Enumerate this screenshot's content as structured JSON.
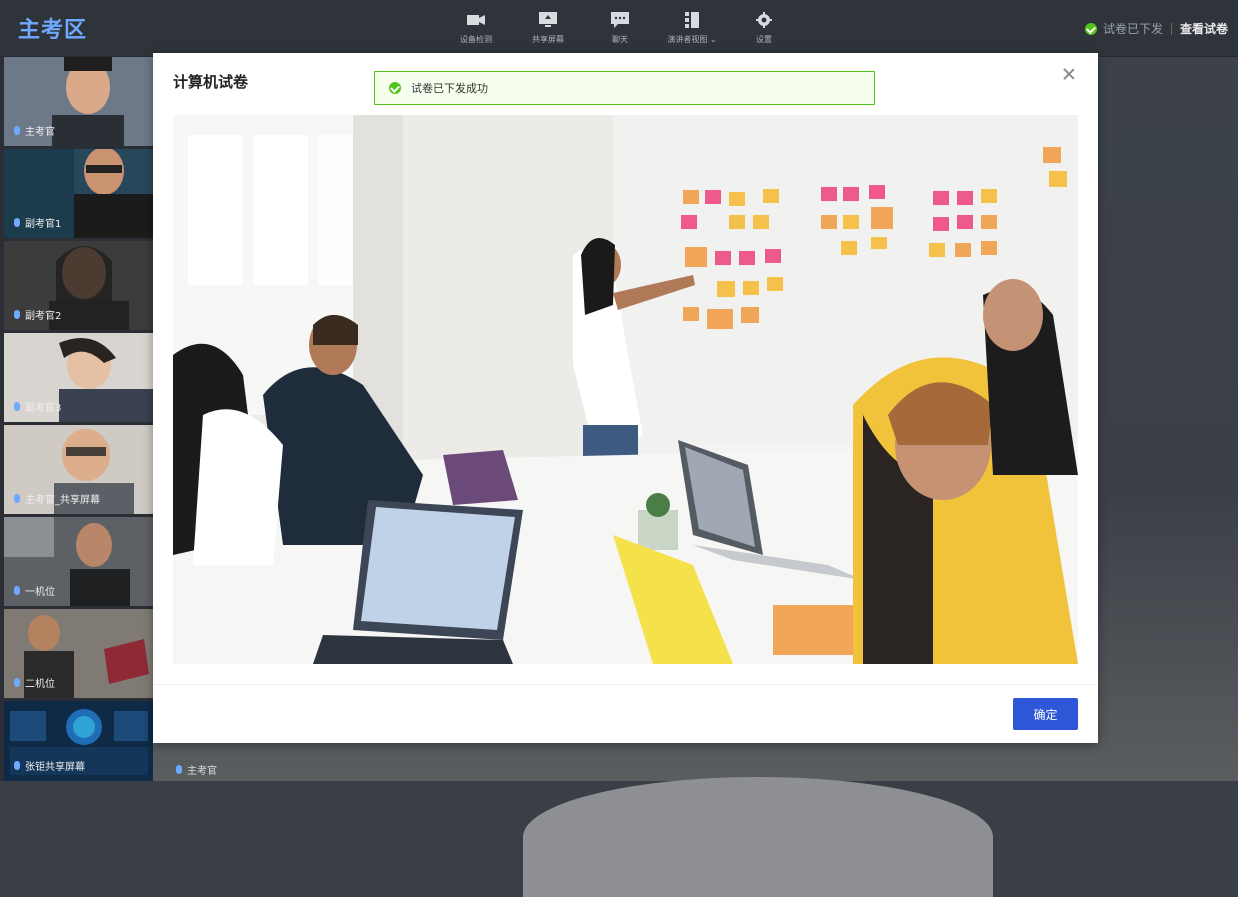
{
  "app": {
    "title": "主考区"
  },
  "toolbar": {
    "tools": [
      {
        "label": "设备检测",
        "icon": "camera-icon"
      },
      {
        "label": "共享屏幕",
        "icon": "share-screen-icon"
      },
      {
        "label": "聊天",
        "icon": "chat-icon"
      },
      {
        "label": "演讲者视图",
        "icon": "speaker-view-icon"
      },
      {
        "label": "设置",
        "icon": "gear-icon"
      }
    ]
  },
  "status": {
    "text": "试卷已下发",
    "link": "查看试卷"
  },
  "participants": [
    {
      "label": "主考官"
    },
    {
      "label": "副考官1"
    },
    {
      "label": "副考官2"
    },
    {
      "label": "副考官3"
    },
    {
      "label": "主考官_共享屏幕"
    },
    {
      "label": "一机位"
    },
    {
      "label": "二机位"
    },
    {
      "label": "张钜共享屏幕"
    }
  ],
  "bottom": {
    "label": "主考官"
  },
  "modal": {
    "title": "计算机试卷",
    "toast": "试卷已下发成功",
    "confirm": "确定"
  },
  "colors": {
    "accent": "#2d57d6",
    "success": "#52c41a",
    "brand": "#6fa9ff"
  }
}
